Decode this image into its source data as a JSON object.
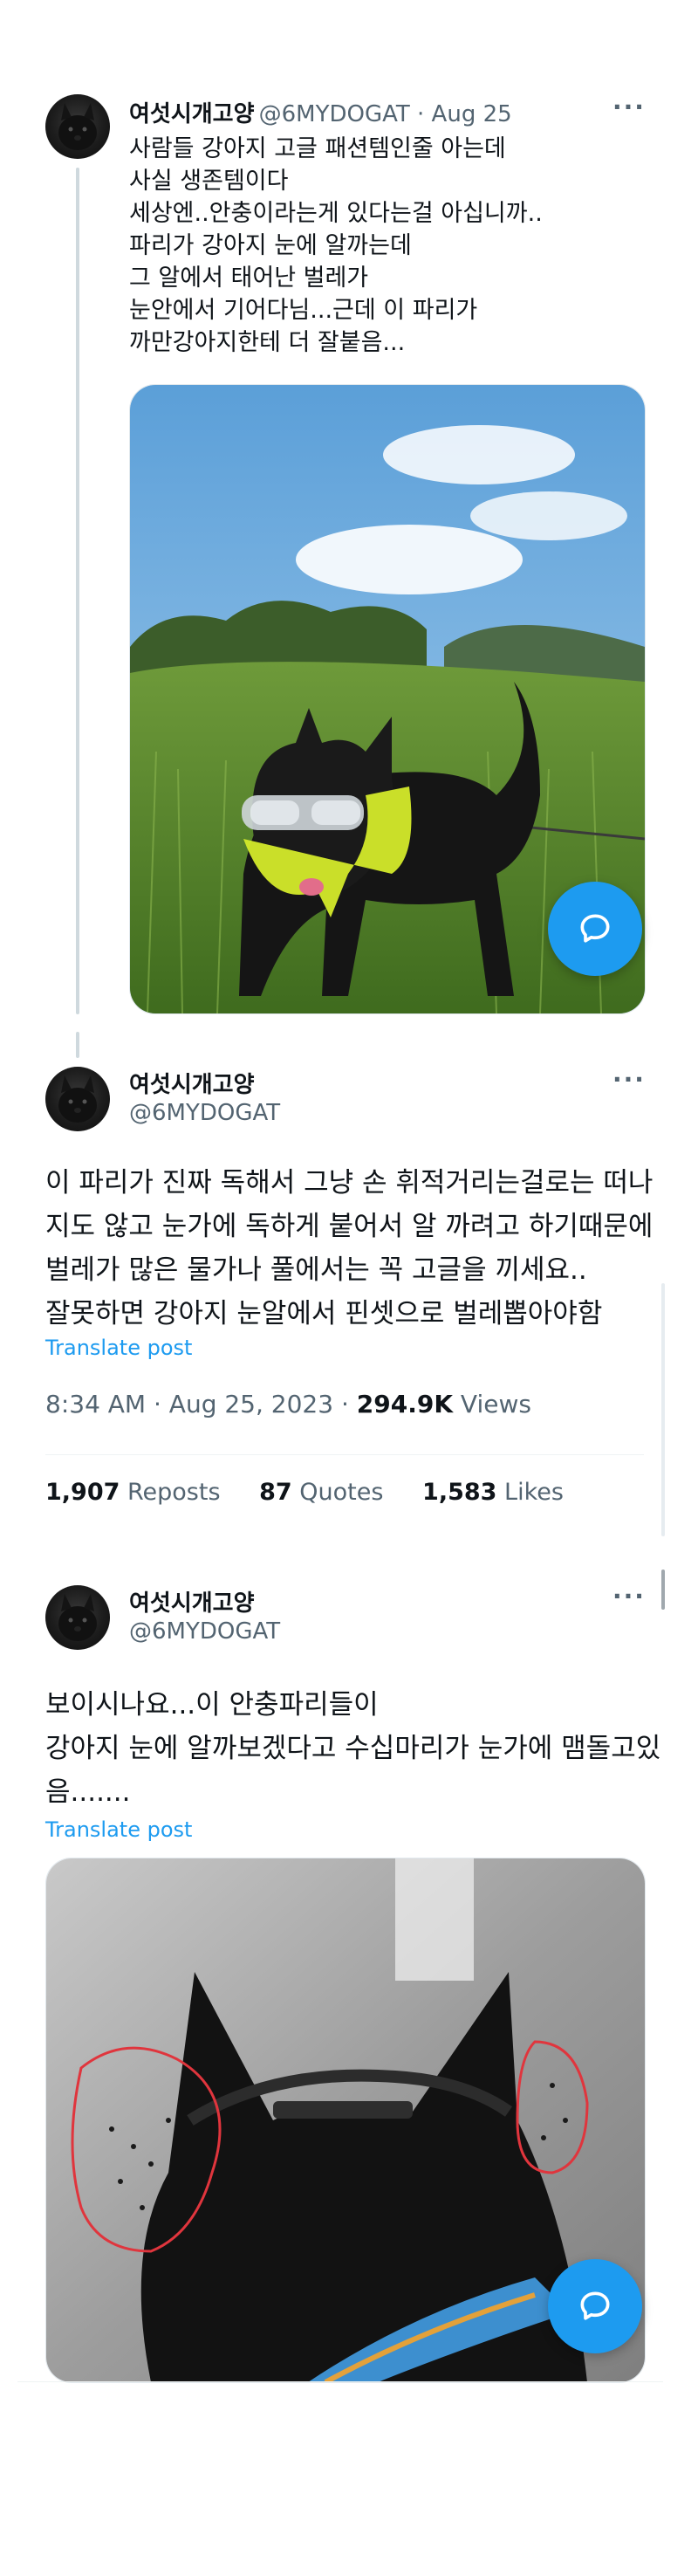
{
  "tweet1": {
    "display_name": "여섯시개고양",
    "handle_date": "@6MYDOGAT · Aug 25",
    "more": "···",
    "text": "사람들 강아지 고글 패션템인줄 아는데\n사실 생존템이다\n세상엔..안충이라는게 있다는걸 아십니까..\n파리가 강아지 눈에 알까는데\n그 알에서 태어난 벌레가\n눈안에서 기어다님...근데 이 파리가\n까만강아지한테 더 잘붙음..."
  },
  "tweet2": {
    "display_name": "여섯시개고양",
    "handle": "@6MYDOGAT",
    "more": "···",
    "text": "이 파리가 진짜 독해서 그냥 손 휘적거리는걸로는 떠나\n지도 않고 눈가에 독하게 붙어서 알 까려고 하기때문에\n벌레가 많은 물가나 풀에서는 꼭 고글을 끼세요..\n잘못하면 강아지 눈알에서 핀셋으로 벌레뽑아야함",
    "translate": "Translate post",
    "timestamp": "8:34 AM · Aug 25, 2023 · ",
    "views_count": "294.9K",
    "views_label": " Views",
    "reposts_count": "1,907",
    "reposts_label": " Reposts",
    "quotes_count": "87",
    "quotes_label": " Quotes",
    "likes_count": "1,583",
    "likes_label": " Likes"
  },
  "tweet3": {
    "display_name": "여섯시개고양",
    "handle": "@6MYDOGAT",
    "more": "···",
    "text": "보이시나요...이 안충파리들이\n강아지 눈에 알까보겠다고 수십마리가 눈가에 맴돌고있\n음.......",
    "translate": "Translate post"
  },
  "icons": {
    "reply_fab": "reply-bubble-icon"
  },
  "colors": {
    "accent": "#1d9bf0",
    "secondary_text": "#536471",
    "primary_text": "#0f1419"
  }
}
